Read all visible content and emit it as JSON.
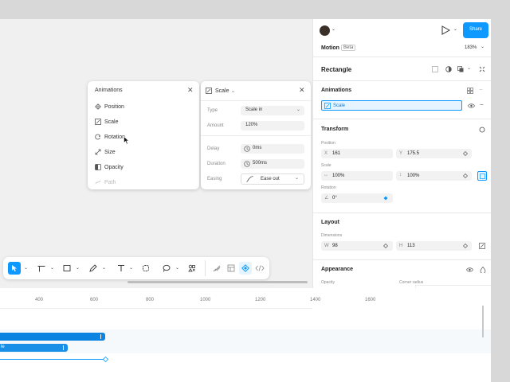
{
  "share_label": "Share",
  "zoom": "183%",
  "motion": {
    "label": "Motion",
    "badge": "Beta"
  },
  "selection_name": "Rectangle",
  "animations_popup": {
    "title": "Animations",
    "items": [
      "Position",
      "Scale",
      "Rotation",
      "Size",
      "Opacity",
      "Path"
    ]
  },
  "scale_popup": {
    "title": "Scale",
    "type_label": "Type",
    "type_value": "Scale in",
    "amount_label": "Amount",
    "amount_value": "120%",
    "delay_label": "Delay",
    "delay_value": "0ms",
    "duration_label": "Duration",
    "duration_value": "500ms",
    "easing_label": "Easing",
    "easing_value": "Ease out"
  },
  "right_panel": {
    "animations_title": "Animations",
    "animation_item": "Scale",
    "transform_title": "Transform",
    "position_label": "Position",
    "x_prefix": "X",
    "x_value": "161",
    "y_prefix": "Y",
    "y_value": "175.5",
    "scale_label": "Scale",
    "scale_x": "100%",
    "scale_y": "100%",
    "rotation_label": "Rotation",
    "rotation_value": "0°",
    "layout_title": "Layout",
    "dimensions_label": "Dimensions",
    "w_prefix": "W",
    "w_value": "98",
    "h_prefix": "H",
    "h_value": "113",
    "appearance_title": "Appearance",
    "opacity_label": "Opacity",
    "corner_label": "Corner radius"
  },
  "timeline": {
    "ticks": [
      "400",
      "600",
      "800",
      "1000",
      "1200",
      "1400",
      "1600"
    ],
    "bar2_label": "le"
  },
  "colors": {
    "accent": "#0d99ff",
    "bar": "#0a84e0"
  }
}
